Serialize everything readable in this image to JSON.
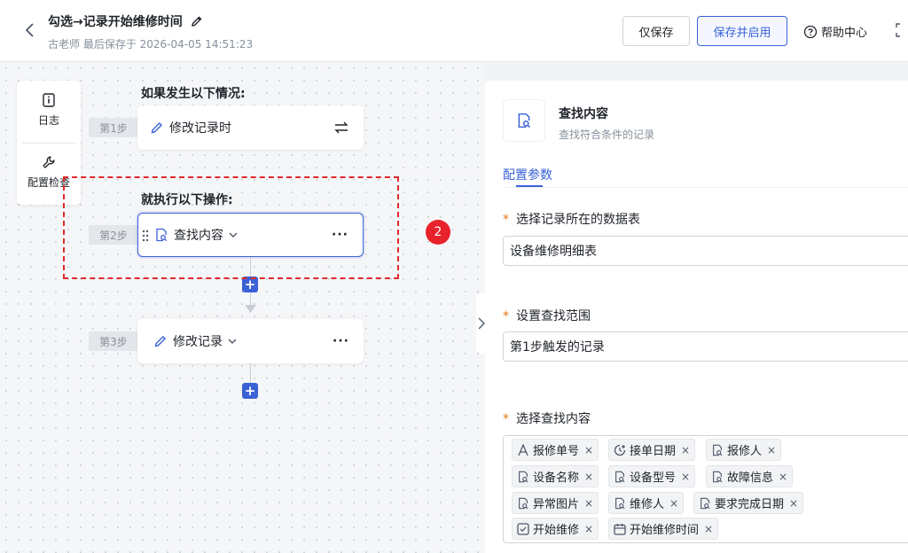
{
  "header": {
    "title": "勾选→记录开始维修时间",
    "subtitle": "古老师 最后保存于 2026-04-05 14:51:23",
    "save_label": "仅保存",
    "save_enable_label": "保存并启用",
    "help_label": "帮助中心"
  },
  "toolbar": {
    "log_label": "日志",
    "check_label": "配置检查"
  },
  "flow": {
    "trigger_heading": "如果发生以下情况:",
    "action_heading": "就执行以下操作:",
    "step1": {
      "tag": "第1步",
      "label": "修改记录时"
    },
    "step2": {
      "tag": "第2步",
      "label": "查找内容",
      "more": "···"
    },
    "step3": {
      "tag": "第3步",
      "label": "修改记录",
      "more": "···"
    },
    "badge": "2"
  },
  "panel": {
    "title": "查找内容",
    "subtitle": "查找符合条件的记录",
    "tab": "配置参数",
    "field1_label": "选择记录所在的数据表",
    "field1_value": "设备维修明细表",
    "field2_label": "设置查找范围",
    "field2_value": "第1步触发的记录",
    "field3_label": "选择查找内容",
    "required_mark": "*",
    "tags": [
      "报修单号",
      "接单日期",
      "报修人",
      "设备名称",
      "设备型号",
      "故障信息",
      "异常图片",
      "维修人",
      "要求完成日期",
      "开始维修",
      "开始维修时间"
    ],
    "tag_remove": "×"
  },
  "colors": {
    "accent": "#3a62d6",
    "highlight": "#e02a2a",
    "required": "#e8750f"
  }
}
